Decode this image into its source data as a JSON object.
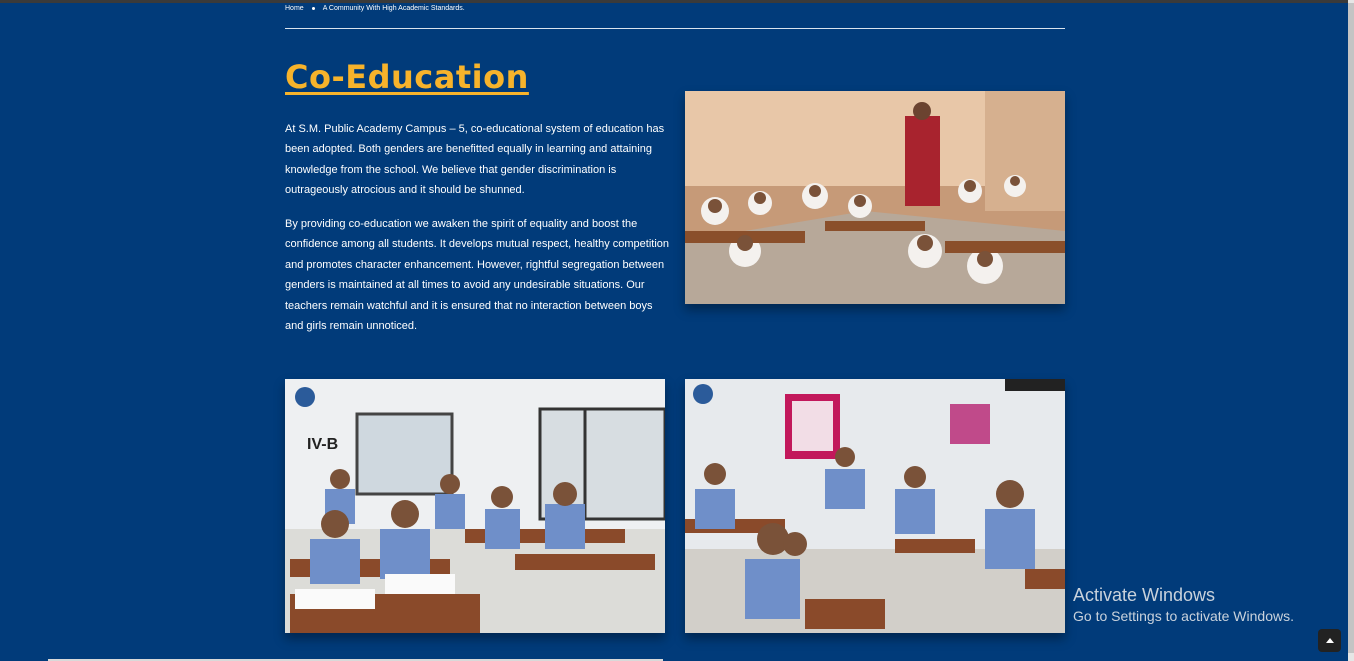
{
  "breadcrumb": {
    "home": "Home",
    "current": "A Community With High Academic Standards."
  },
  "page": {
    "title": "Co-Education",
    "paragraphs": [
      "At S.M. Public Academy Campus – 5, co-educational system of education has been adopted. Both genders are benefitted equally in learning and attaining knowledge from the school. We believe that gender discrimination is outrageously atrocious and it should be shunned.",
      "By providing co-education we awaken the spirit of equality and boost the confidence among all students. It develops mutual respect, healthy competition and promotes character enhancement. However, rightful segregation between genders is maintained at all times to avoid any undesirable situations. Our teachers remain watchful and it is ensured that no interaction between boys and girls remain unnoticed."
    ]
  },
  "photos": {
    "classroom_sign": "IV-B"
  },
  "watermark": {
    "line1": "Activate Windows",
    "line2": "Go to Settings to activate Windows."
  },
  "colors": {
    "background": "#013b7a",
    "title": "#f7b32b",
    "text": "#ffffff"
  },
  "icons": {
    "back_to_top": "chevron-up-icon"
  }
}
